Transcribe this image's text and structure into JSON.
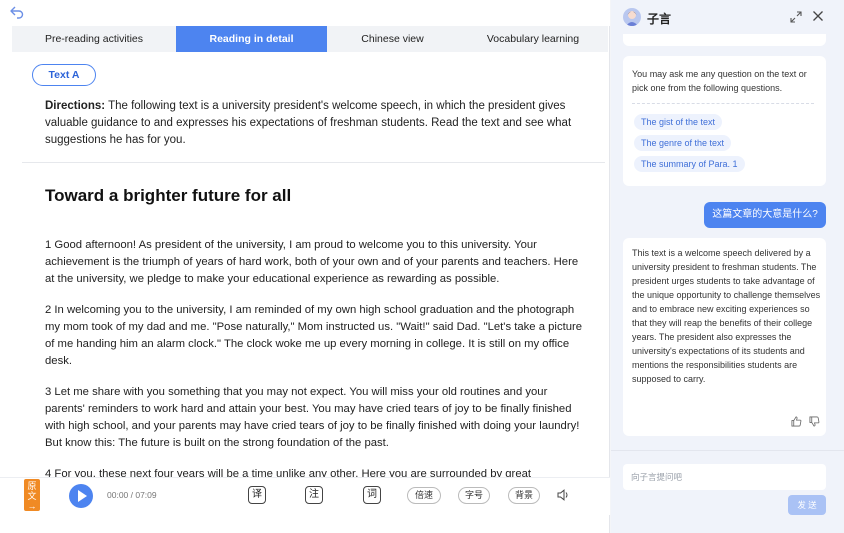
{
  "tabs": [
    {
      "label": "Pre-reading activities"
    },
    {
      "label": "Reading in detail"
    },
    {
      "label": "Chinese view"
    },
    {
      "label": "Vocabulary learning"
    }
  ],
  "text_pill": "Text A",
  "directions": {
    "label": "Directions:",
    "body": "The following text is a university president's welcome speech, in which the president gives valuable guidance to and expresses his expectations of freshman students. Read the text and see what suggestions he has for you."
  },
  "article": {
    "title": "Toward a brighter future for all",
    "paragraphs": [
      "1 Good afternoon! As president of the university, I am proud to welcome you to this university. Your achievement is the triumph of years of hard work, both of your own and of your parents and teachers. Here at the university, we pledge to make your educational experience as rewarding as possible.",
      "2 In welcoming you to the university, I am reminded of my own high school graduation and the photograph my mom took of my dad and me. \"Pose naturally,\" Mom instructed us. \"Wait!\" said Dad. \"Let's take a picture of me handing him an alarm clock.\" The clock woke me up every morning in college. It is still on my office desk.",
      "3 Let me share with you something that you may not expect. You will miss your old routines and your parents' reminders to work hard and attain your best. You may have cried tears of joy to be finally finished with high school, and your parents may have cried tears of joy to be finally finished with doing your laundry! But know this: The future is built on the strong foundation of the past.",
      "4 For you, these next four years will be a time unlike any other. Here you are surrounded by great"
    ]
  },
  "player": {
    "original_label": "原文",
    "time": "00:00 / 07:09",
    "btn_translate": "译",
    "btn_note": "注",
    "btn_word": "词",
    "btn_speed": "倍速",
    "btn_fontsize": "字号",
    "btn_background": "背景"
  },
  "assistant": {
    "name": "子言",
    "intro": "You may ask me any question on the text or pick one from the following questions.",
    "suggestions": [
      "The gist of the text",
      "The genre of the text",
      "The summary of Para. 1"
    ],
    "user_question": "这篇文章的大意是什么?",
    "answer": "This text is a welcome speech delivered by a university president to freshman students. The president urges students to take advantage of the unique opportunity to challenge themselves and to embrace new exciting experiences so that they will reap the benefits of their college years. The president also expresses the university's expectations of its students and mentions the responsibilities students are supposed to carry.",
    "input_placeholder": "向子言提问吧",
    "send_label": "发 送"
  },
  "colors": {
    "accent": "#4d84f0",
    "original_badge": "#f08a24"
  }
}
